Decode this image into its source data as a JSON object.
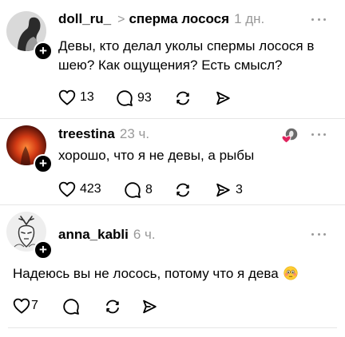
{
  "posts": [
    {
      "username": "doll_ru_",
      "topic": "сперма лосося",
      "time": "1 дн.",
      "text": "Девы, кто делал уколы спермы лосося в шею? Как ощущения? Есть смысл?",
      "likes": "13",
      "comments": "93",
      "reposts": "",
      "shares": ""
    },
    {
      "username": "treestina",
      "time": "23 ч.",
      "text": "хорошо, что я не девы, а рыбы",
      "likes": "423",
      "comments": "8",
      "reposts": "",
      "shares": "3"
    },
    {
      "username": "anna_kabli",
      "time": "6 ч.",
      "text": "Надеюсь вы не лосось, потому что я дева",
      "likes": "7",
      "comments": "",
      "reposts": "",
      "shares": ""
    }
  ],
  "icons": {
    "like": "heart-icon",
    "comment": "comment-icon",
    "repost": "repost-icon",
    "share": "share-icon",
    "more": "more-icon",
    "follow": "plus-icon",
    "reaction": "liked-by-icon",
    "emoji": "flushed-face-emoji"
  },
  "colors": {
    "text": "#000000",
    "secondary": "#999999",
    "divider": "#e6e6e6",
    "reaction_heart": "#e0245e"
  }
}
